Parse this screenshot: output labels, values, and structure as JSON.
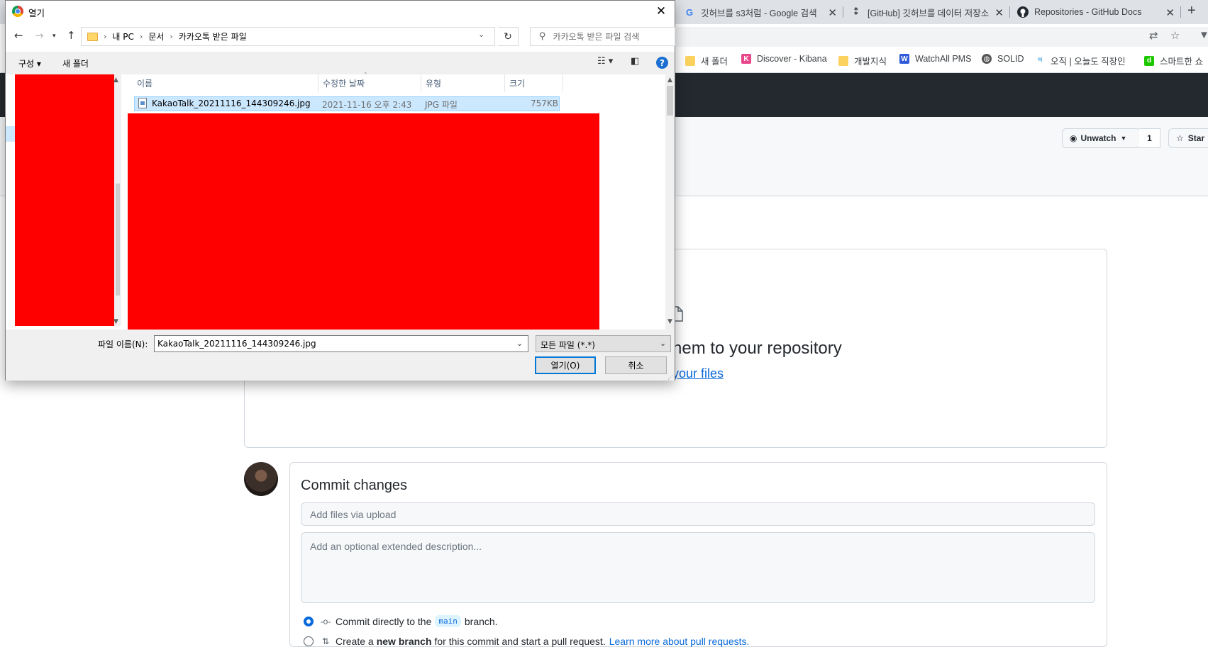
{
  "browser": {
    "tabs": [
      {
        "title": "깃허브를 s3처럼 - Google 검색",
        "favicon": "google-icon"
      },
      {
        "title": "[GitHub] 깃허브를 데이터 저장소",
        "favicon": "blog-icon"
      },
      {
        "title": "Repositories - GitHub Docs",
        "favicon": "github-icon"
      }
    ],
    "tab_close": "✕",
    "new_tab": "+",
    "bookmarks": [
      {
        "label": "새 폴더",
        "icon": "folder-icon"
      },
      {
        "label": "Discover - Kibana",
        "icon": "kibana-icon"
      },
      {
        "label": "개발지식",
        "icon": "folder-icon"
      },
      {
        "label": "WatchAll PMS",
        "icon": "watchall-icon"
      },
      {
        "label": "SOLID",
        "icon": "globe-icon"
      },
      {
        "label": "오직 | 오늘도 직장인",
        "icon": "oj-icon"
      },
      {
        "label": "스마트한 쇼",
        "icon": "d-icon"
      }
    ]
  },
  "github": {
    "unwatch_label": "Unwatch",
    "watch_count": "1",
    "star_label": "Star",
    "drop_title": "hem to your repository",
    "drop_link": "your files",
    "commit": {
      "title": "Commit changes",
      "summary_placeholder": "Add files via upload",
      "description_placeholder": "Add an optional extended description...",
      "option_direct_prefix": "Commit directly to the",
      "branch_name": "main",
      "option_direct_suffix": "branch.",
      "option_new_prefix": "Create a",
      "option_new_bold": "new branch",
      "option_new_suffix": "for this commit and start a pull request.",
      "option_new_link": "Learn more about pull requests."
    }
  },
  "dialog": {
    "title": "열기",
    "close": "✕",
    "breadcrumb": [
      "내 PC",
      "문서",
      "카카오톡 받은 파일"
    ],
    "search_placeholder": "카카오톡 받은 파일 검색",
    "organize_label": "구성 ▾",
    "new_folder_label": "새 폴더",
    "columns": {
      "name": "이름",
      "modified": "수정한 날짜",
      "type": "유형",
      "size": "크기"
    },
    "files": [
      {
        "name": "KakaoTalk_20211116_144309246.jpg",
        "modified": "2021-11-16 오후 2:43",
        "type": "JPG 파일",
        "size": "757KB"
      }
    ],
    "filename_label": "파일 이름(N):",
    "filename_value": "KakaoTalk_20211116_144309246.jpg",
    "filetype_value": "모든 파일 (*.*)",
    "open_button": "열기(O)",
    "cancel_button": "취소"
  }
}
